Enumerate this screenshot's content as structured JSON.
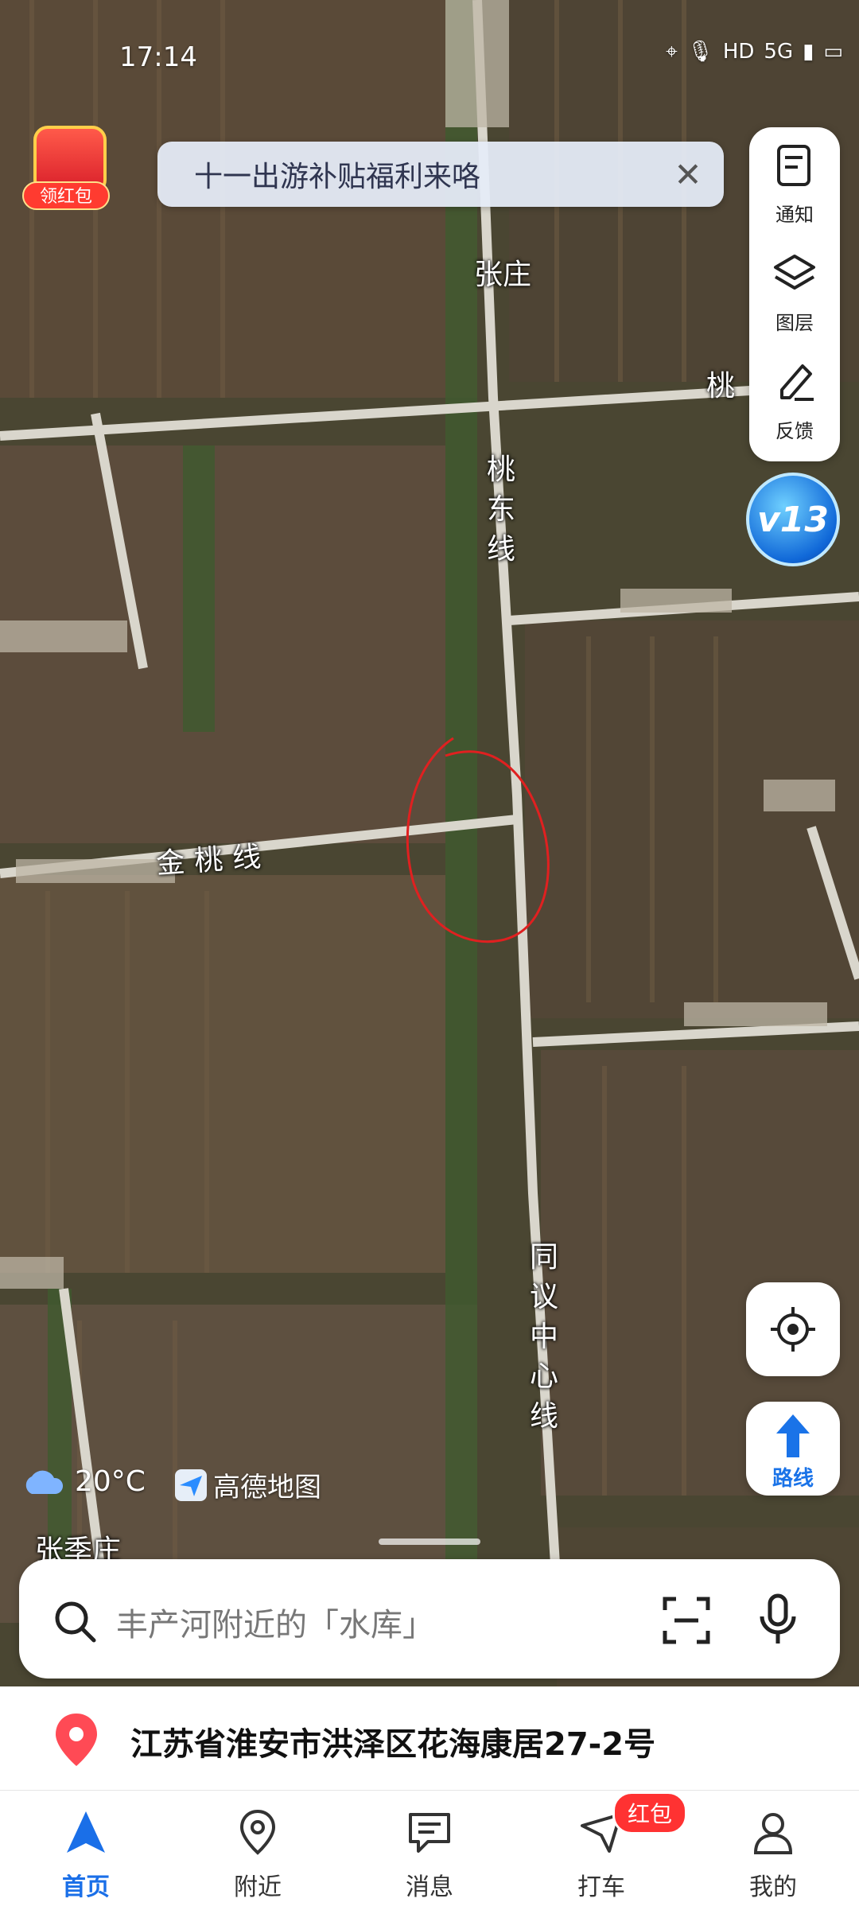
{
  "status_bar": {
    "time": "17:14",
    "icons": [
      "location-icon",
      "mic-icon",
      "HD",
      "5G",
      "signal-icon",
      "battery-icon"
    ]
  },
  "promo": {
    "label": "领红包"
  },
  "banner": {
    "text": "十一出游补贴福利来咯",
    "close_icon": "close-icon"
  },
  "right_panel": {
    "items": [
      {
        "label": "通知",
        "icon": "notice-icon"
      },
      {
        "label": "图层",
        "icon": "layers-icon"
      },
      {
        "label": "反馈",
        "icon": "feedback-icon"
      }
    ]
  },
  "version_badge": "v13",
  "map_labels": {
    "zhangzhuang": "张庄",
    "taodong": "桃东线",
    "jintao": "金桃线",
    "tongyi": "同议中心线",
    "zhangjizhuang": "张季庄",
    "tao_right": "桃"
  },
  "route_button": {
    "label": "路线"
  },
  "weather": {
    "temperature": "20°C",
    "icon": "cloud-icon"
  },
  "brand": {
    "name": "高德地图"
  },
  "search": {
    "placeholder": "丰产河附近的「水库」"
  },
  "current_address": {
    "text": "江苏省淮安市洪泽区花海康居27-2号"
  },
  "tabbar": {
    "tabs": [
      {
        "label": "首页",
        "icon": "navigate-icon",
        "active": true
      },
      {
        "label": "附近",
        "icon": "nearby-icon",
        "active": false
      },
      {
        "label": "消息",
        "icon": "message-icon",
        "active": false
      },
      {
        "label": "打车",
        "icon": "taxi-icon",
        "active": false
      },
      {
        "label": "我的",
        "icon": "profile-icon",
        "active": false
      }
    ],
    "badge": "红包"
  },
  "colors": {
    "accent": "#1a6fe8",
    "badge": "#ff3232",
    "annotation": "#e02020"
  }
}
